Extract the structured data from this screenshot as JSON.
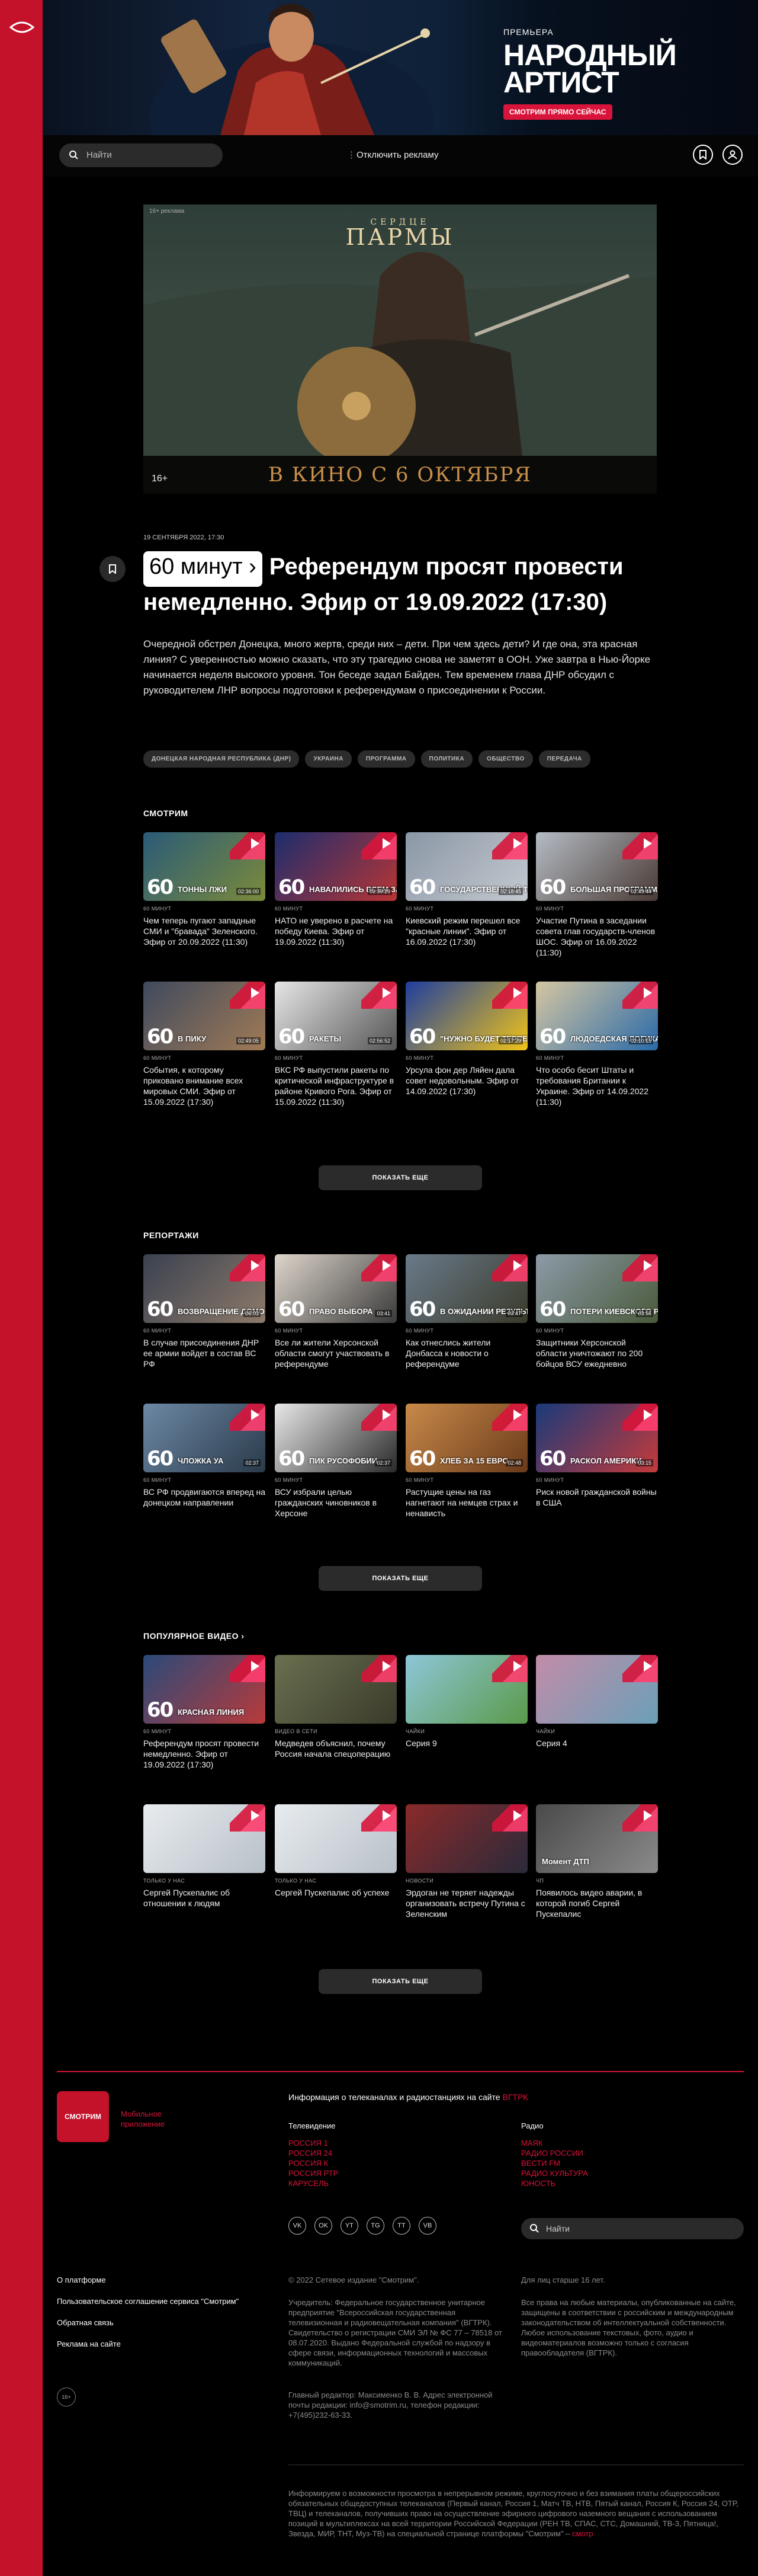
{
  "banner": {
    "eyebrow": "ПРЕМЬЕРА",
    "title_line1": "НАРОДНЫЙ",
    "title_line2": "АРТИСТ",
    "cta": "СМОТРИМ ПРЯМО СЕЙЧАС"
  },
  "topbar": {
    "search_placeholder": "Найти",
    "ads_label": "Отключить рекламу"
  },
  "hero_ad": {
    "age_note": "16+ реклама",
    "brand_top": "СЕРДЦЕ",
    "brand_main": "ПАРМЫ",
    "date_text": "В КИНО С 6 ОКТЯБРЯ",
    "rating": "16+"
  },
  "article": {
    "date": "19 СЕНТЯБРЯ 2022, 17:30",
    "badge": "60 минут",
    "title": "Референдум просят провести немедленно. Эфир от 19.09.2022 (17:30)",
    "lead": "Очередной обстрел Донецка, много жертв, среди них – дети. При чем здесь дети? И где она, эта красная линия? С уверенностью можно сказать, что эту трагедию снова не заметят в ООН. Уже завтра в Нью-Йорке начинается неделя высокого уровня. Тон беседе задал Байден. Тем временем глава ДНР обсудил с руководителем ЛНР вопросы подготовки к референдумам о присоединении к России.",
    "tags": [
      "ДОНЕЦКАЯ НАРОДНАЯ РЕСПУБЛИКА (ДНР)",
      "УКРАИНА",
      "ПРОГРАММА",
      "ПОЛИТИКА",
      "ОБЩЕСТВО",
      "ПЕРЕДАЧА"
    ]
  },
  "watch": {
    "title": "СМОТРИМ",
    "more": "ПОКАЗАТЬ ЕЩЕ",
    "cards": [
      {
        "src": "60 МИНУТ",
        "text": "Чем теперь пугают западные СМИ и \"бравада\" Зеленского. Эфир от 20.09.2022 (11:30)",
        "cap": "ТОННЫ ЛЖИ",
        "dur": "02:36:00",
        "c1": "#2a5b78",
        "c2": "#7b8a3a"
      },
      {
        "src": "60 МИНУТ",
        "text": "НАТО не уверено в расчете на победу Киева. Эфир от 19.09.2022 (11:30)",
        "cap": "НАВАЛИЛИСЬ ВСЕМ ЗА",
        "dur": "02:39:29",
        "c1": "#1c2d6e",
        "c2": "#b83535"
      },
      {
        "src": "60 МИНУТ",
        "text": "Киевский режим перешел все \"красные линии\". Эфир от 16.09.2022 (17:30)",
        "cap": "ГОСУДАРСТВЕННЫЙ ТЕРРОРИЗМ",
        "dur": "02:18:45",
        "c1": "#8b97a6",
        "c2": "#c4c9cf"
      },
      {
        "src": "60 МИНУТ",
        "text": "Участие Путина в заседании совета глав государств-членов ШОС. Эфир от 16.09.2022 (11:30)",
        "cap": "БОЛЬШАЯ ПРОГРАММА",
        "dur": "02:49:44",
        "c1": "#b4bcc4",
        "c2": "#4a3a35"
      },
      {
        "src": "60 МИНУТ",
        "text": "События, к которому приковано внимание всех мировых СМИ. Эфир от 15.09.2022 (17:30)",
        "cap": "В ПИКУ",
        "dur": "02:49:05",
        "c1": "#3f4a5e",
        "c2": "#a07a55"
      },
      {
        "src": "60 МИНУТ",
        "text": "ВКС РФ выпустили ракеты по критической инфраструктуре в районе Кривого Рога. Эфир от 15.09.2022 (11:30)",
        "cap": "РАКЕТЫ",
        "dur": "02:56:52",
        "c1": "#e6e6e6",
        "c2": "#555"
      },
      {
        "src": "60 МИНУТ",
        "text": "Урсула фон дер Ляйен дала совет недовольным. Эфир от 14.09.2022 (17:30)",
        "cap": "\"НУЖНО БУДЕТ ТЕРПЕТЬ\"",
        "dur": "02:17:29",
        "c1": "#1e3e9e",
        "c2": "#f0c419"
      },
      {
        "src": "60 МИНУТ",
        "text": "Что особо бесит Штаты и требования Британии к Украине. Эфир от 14.09.2022 (11:30)",
        "cap": "ЛЮДОЕДСКАЯ ЛОГИКА",
        "dur": "02:10:15",
        "c1": "#d5c6a2",
        "c2": "#2a6aa8"
      }
    ]
  },
  "reports": {
    "title": "РЕПОРТАЖИ",
    "more": "ПОКАЗАТЬ ЕЩЕ",
    "cards": [
      {
        "src": "60 МИНУТ",
        "text": "В случае присоединения ДНР ее армии войдет в состав ВС РФ",
        "cap": "ВОЗВРАЩЕНИЕ ДОМОЙ",
        "dur": "05:03",
        "c1": "#3a4150",
        "c2": "#8d7a6a"
      },
      {
        "src": "60 МИНУТ",
        "text": "Все ли жители Херсонской области смогут участвовать в референдуме",
        "cap": "ПРАВО ВЫБОРА",
        "dur": "03:41",
        "c1": "#ded6cc",
        "c2": "#3a3a3a"
      },
      {
        "src": "60 МИНУТ",
        "text": "Как отнеслись жители Донбасса к новости о референдуме",
        "cap": "В ОЖИДАНИИ РЕЗУЛЬТАТА",
        "dur": "03:47",
        "c1": "#6a7a8a",
        "c2": "#3a3a2a"
      },
      {
        "src": "60 МИНУТ",
        "text": "Защитники Херсонской области уничтожают по 200 бойцов ВСУ ежедневно",
        "cap": "ПОТЕРИ КИЕВСКОГО РЕЖИМА",
        "dur": "03:55",
        "c1": "#8c9aa8",
        "c2": "#4a5a3a"
      },
      {
        "src": "60 МИНУТ",
        "text": "ВС РФ продвигаются вперед на донецком направлении",
        "cap": "ЧЛОЖКА УА",
        "dur": "02:37",
        "c1": "#6c88a4",
        "c2": "#2a3a4a"
      },
      {
        "src": "60 МИНУТ",
        "text": "ВСУ избрали целью гражданских чиновников в Херсоне",
        "cap": "ПИК РУСОФОБИИ",
        "dur": "02:37",
        "c1": "#e8e8e8",
        "c2": "#2a2a2a"
      },
      {
        "src": "60 МИНУТ",
        "text": "Растущие цены на газ нагнетают на немцев страх и ненависть",
        "cap": "ХЛЕБ ЗА 15 ЕВРО",
        "dur": "02:48",
        "c1": "#c88a4a",
        "c2": "#6a3a1a"
      },
      {
        "src": "60 МИНУТ",
        "text": "Риск новой гражданской войны в США",
        "cap": "РАСКОЛ АМЕРИКИ",
        "dur": "03:15",
        "c1": "#1a3a7a",
        "c2": "#c43a3a"
      }
    ]
  },
  "popular": {
    "title": "ПОПУЛЯРНОЕ ВИДЕО",
    "arrow": "›",
    "more": "ПОКАЗАТЬ ЕЩЕ",
    "cards": [
      {
        "src": "60 МИНУТ",
        "text": "Референдум просят провести немедленно. Эфир от 19.09.2022 (17:30)",
        "cap": "КРАСНАЯ ЛИНИЯ",
        "dur": "",
        "c1": "#2a4a7a",
        "c2": "#b83a3a"
      },
      {
        "src": "ВИДЕО В СЕТИ",
        "text": "Медведев объяснил, почему Россия начала спецоперацию",
        "cap": "",
        "dur": "",
        "c1": "#6a7050",
        "c2": "#3a3a2a"
      },
      {
        "src": "ЧАЙКИ",
        "text": "Серия 9",
        "cap": "",
        "dur": "",
        "c1": "#8ec6d8",
        "c2": "#5a9a4a"
      },
      {
        "src": "ЧАЙКИ",
        "text": "Серия 4",
        "cap": "",
        "dur": "",
        "c1": "#c28ca8",
        "c2": "#6aa0b8"
      },
      {
        "src": "ТОЛЬКО У НАС",
        "text": "Сергей Пускепалис об отношении к людям",
        "cap": "",
        "dur": "",
        "c1": "#e8ecef",
        "c2": "#b8c0c8"
      },
      {
        "src": "ТОЛЬКО У НАС",
        "text": "Сергей Пускепалис об успехе",
        "cap": "",
        "dur": "",
        "c1": "#e8ecef",
        "c2": "#b8c0c8"
      },
      {
        "src": "НОВОСТИ",
        "text": "Эрдоган не теряет надежды организовать встречу Путина с Зеленским",
        "cap": "",
        "dur": "",
        "c1": "#8a2a2a",
        "c2": "#2a2a3a"
      },
      {
        "src": "ЧП",
        "text": "Появилось видео аварии, в которой погиб Сергей Пускепалис",
        "cap": "Момент ДТП",
        "dur": "",
        "c1": "#4a4a4a",
        "c2": "#8a8a8a"
      }
    ]
  },
  "footer": {
    "logo": "СМОТРИМ",
    "app_line1": "Мобильное",
    "app_line2": "приложение",
    "info_text": "Информация о телеканалах и радиостанциях на сайте",
    "info_link": "ВГТРК",
    "tv_title": "Телевидение",
    "tv_links": [
      "РОССИЯ 1",
      "РОССИЯ 24",
      "РОССИЯ К",
      "РОССИЯ РТР",
      "КАРУСЕЛЬ"
    ],
    "radio_title": "Радио",
    "radio_links": [
      "МАЯК",
      "РАДИО РОССИИ",
      "ВЕСТИ FM",
      "РАДИО КУЛЬТУРА",
      "ЮНОСТЬ"
    ],
    "socials": [
      "VK",
      "OK",
      "YT",
      "TG",
      "TT",
      "VB"
    ],
    "search_placeholder": "Найти",
    "links": [
      "О платформе",
      "Пользовательское соглашение сервиса \"Смотрим\"",
      "Обратная связь",
      "Реклама на сайте"
    ],
    "age": "16+",
    "copyright": "© 2022 Сетевое издание \"Смотрим\".",
    "age_note": "Для лиц старше 16 лет.",
    "founder": "Учредитель: Федеральное государственное унитарное предприятие \"Всероссийская государственная телевизионная и радиовещательная компания\" (ВГТРК). Свидетельство о регистрации СМИ ЭЛ № ФС 77 – 78518 от 08.07.2020. Выдано Федеральной службой по надзору в сфере связи, информационных технологий и массовых коммуникаций.",
    "rights": "Все права на любые материалы, опубликованные на сайте, защищены в соответствии с российским и международным законодательством об интеллектуальной собственности. Любое использование текстовых, фото, аудио и видеоматериалов возможно только с согласия правообладателя (ВГТРК).",
    "editor": "Главный редактор: Максименко В. В. Адрес электронной почты редакции: info@smotrim.ru, телефон редакции: +7(495)232-63-33.",
    "notice": "Информируем о возможности просмотра в непрерывном режиме, круглосуточно и без взимания платы общероссийских обязательных общедоступных телеканалов (Первый канал, Россия 1, Матч ТВ, НТВ, Пятый канал, Россия К, Россия 24, ОТР, ТВЦ) и телеканалов, получивших право на осуществление эфирного цифрового наземного вещания с использованием позиций в мультиплексах на всей территории Российской Федерации (РЕН ТВ, СПАС, СТС, Домашний, ТВ-3, Пятница!, Звезда, МИР, ТНТ, Муз-ТВ) на специальной странице платформы \"Смотрим\" –",
    "notice_link": "смотр"
  }
}
